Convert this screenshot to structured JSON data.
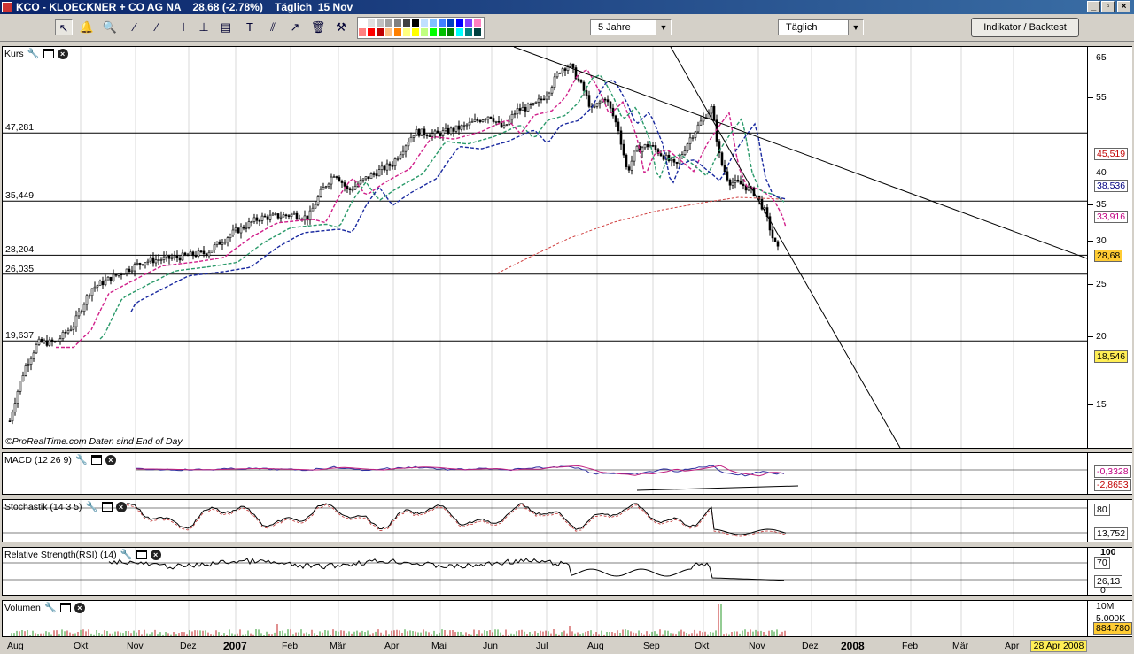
{
  "window": {
    "title": "KCO - KLOECKNER + CO AG NA    28,68 (-2,78%)    Täglich  15 Nov",
    "min": "_",
    "max": "▫",
    "close": "×"
  },
  "toolbar": {
    "icons": [
      "pointer-icon",
      "alarm-bell-icon",
      "zoom-icon",
      "line-icon",
      "ray-icon",
      "horizontal-line-icon",
      "vertical-line-icon",
      "fibonacci-icon",
      "text-icon",
      "parallel-lines-icon",
      "arrow-icon",
      "trash-icon",
      "settings-tools-icon"
    ],
    "glyphs": [
      "↖",
      "🔔",
      "🔍",
      "⁄",
      "⁄",
      "⊣",
      "⊥",
      "▤",
      "T",
      "⫽",
      "↗",
      "🗑",
      "⚒"
    ],
    "palette": [
      "#ffffff",
      "#e0e0e0",
      "#c0c0c0",
      "#a0a0a0",
      "#808080",
      "#404040",
      "#000000",
      "#c0e0ff",
      "#80c0ff",
      "#4080ff",
      "#0040c0",
      "#0000ff",
      "#8040ff",
      "#ff80c0",
      "#ff8080",
      "#ff0000",
      "#c00000",
      "#ffc080",
      "#ff8000",
      "#ffff80",
      "#ffff00",
      "#c0ff80",
      "#00ff00",
      "#00c000",
      "#008000",
      "#00ffff",
      "#008080",
      "#004040"
    ],
    "period": "5 Jahre",
    "interval": "Täglich",
    "indicator_button": "Indikator / Backtest"
  },
  "price_panel": {
    "title": "Kurs",
    "watermark": "©ProRealTime.com  Daten sind End of Day",
    "hlines": [
      {
        "label": "47,281",
        "v": 47.281
      },
      {
        "label": "35,449",
        "v": 35.449
      },
      {
        "label": "28,204",
        "v": 28.204
      },
      {
        "label": "26,035",
        "v": 26.035
      },
      {
        "label": "19,637",
        "v": 19.637
      }
    ],
    "scale_ticks": [
      "65",
      "55",
      "40",
      "35",
      "30",
      "25",
      "20",
      "15"
    ],
    "tags": [
      {
        "label": "45,519",
        "color": "#c00000",
        "bg": "#ffffff"
      },
      {
        "label": "38,536",
        "color": "#000080",
        "bg": "#ffffff"
      },
      {
        "label": "33,916",
        "color": "#c00080",
        "bg": "#ffffff"
      },
      {
        "label": "28,68",
        "color": "#000000",
        "bg": "#ffcc33"
      },
      {
        "label": "18,546",
        "color": "#000000",
        "bg": "#ffee55"
      }
    ]
  },
  "macd_panel": {
    "title": "MACD (12 26 9)",
    "tags": [
      "-0,3328",
      "-2,8653"
    ]
  },
  "stoch_panel": {
    "title": "Stochastik (14 3 5)",
    "ticks": [
      "80"
    ],
    "tags": [
      "13,752"
    ]
  },
  "rsi_panel": {
    "title": "Relative Strength(RSI) (14)",
    "ticks": [
      "100",
      "70",
      "0"
    ],
    "tags": [
      "26,13"
    ]
  },
  "volume_panel": {
    "title": "Volumen",
    "ticks": [
      "10M",
      "5.000K"
    ],
    "tags": [
      "884.780"
    ]
  },
  "x_axis": {
    "labels": [
      {
        "t": "Aug",
        "b": false
      },
      {
        "t": "Okt",
        "b": false
      },
      {
        "t": "Nov",
        "b": false
      },
      {
        "t": "Dez",
        "b": false
      },
      {
        "t": "2007",
        "b": true
      },
      {
        "t": "Feb",
        "b": false
      },
      {
        "t": "Mär",
        "b": false
      },
      {
        "t": "Apr",
        "b": false
      },
      {
        "t": "Mai",
        "b": false
      },
      {
        "t": "Jun",
        "b": false
      },
      {
        "t": "Jul",
        "b": false
      },
      {
        "t": "Aug",
        "b": false
      },
      {
        "t": "Sep",
        "b": false
      },
      {
        "t": "Okt",
        "b": false
      },
      {
        "t": "Nov",
        "b": false
      },
      {
        "t": "Dez",
        "b": false
      },
      {
        "t": "2008",
        "b": true
      },
      {
        "t": "Feb",
        "b": false
      },
      {
        "t": "Mär",
        "b": false
      },
      {
        "t": "Apr",
        "b": false
      }
    ],
    "end_date": "28 Apr 2008"
  },
  "chart_data": {
    "type": "candlestick",
    "title": "KCO - KLOECKNER + CO AG NA",
    "y_scale": "log",
    "ylim": [
      12.5,
      68
    ],
    "x": [
      "2006-08",
      "2006-10",
      "2006-11",
      "2006-12",
      "2007-01",
      "2007-02",
      "2007-03",
      "2007-04",
      "2007-05",
      "2007-06",
      "2007-07",
      "2007-08",
      "2007-09",
      "2007-10",
      "2007-11"
    ],
    "close": [
      14.5,
      19.5,
      26,
      27.5,
      33,
      33.5,
      40,
      46,
      51,
      53,
      62,
      42,
      45,
      52,
      28.68
    ],
    "moving_averages": [
      "dashed magenta",
      "dashed green",
      "dashed navy",
      "dashed red"
    ],
    "last_close": 28.68,
    "change_pct": -2.78
  }
}
